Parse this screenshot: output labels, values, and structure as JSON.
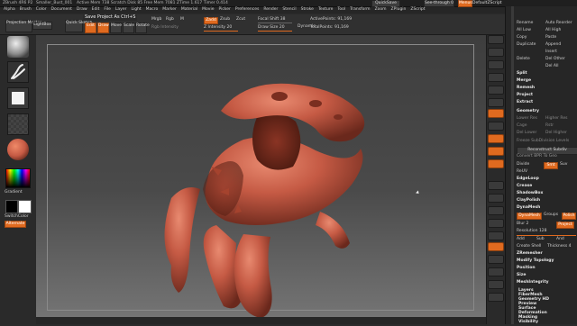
{
  "titlebar": {
    "app": "ZBrush 4R6 P2",
    "doc": "Smaller_Bust_001",
    "stats": "Active Mem 738  Scratch Disk 85  Free Mem 7081  ZTime 1.617  Timer 0.414",
    "quicksave": "QuickSave",
    "seethrough": "See-through 0",
    "menus_label": "Menus",
    "default_script": "DefaultZScript"
  },
  "menubar": [
    "Alpha",
    "Brush",
    "Color",
    "Document",
    "Draw",
    "Edit",
    "File",
    "Layer",
    "Light",
    "Macro",
    "Marker",
    "Material",
    "Movie",
    "Picker",
    "Preferences",
    "Render",
    "Stencil",
    "Stroke",
    "Texture",
    "Tool",
    "Transform",
    "Zoom",
    "ZPlugin",
    "ZScript"
  ],
  "toolbar": {
    "projection_master": "Projection Master",
    "lightbox": "LightBox",
    "quick_sketch": "Quick Sketch",
    "save_tooltip": "Save Project As  Ctrl+S",
    "edit": "Edit",
    "draw": "Draw",
    "move": "Move",
    "scale": "Scale",
    "rotate": "Rotate",
    "mrgb": "Mrgb",
    "rgb": "Rgb",
    "m": "M",
    "rgb_intensity": "Rgb Intensity",
    "zadd": "Zadd",
    "zsub": "Zsub",
    "zcut": "Zcut",
    "z_intensity": "Z Intensity 20",
    "focal_shift": "Focal Shift 38",
    "draw_size": "Draw Size 20",
    "dynamic": "Dynamic",
    "active_points": "ActivePoints: 91,169",
    "total_points": "TotalPoints: 91,169"
  },
  "leftshelf": {
    "gradient": "Gradient",
    "switchcolor": "SwitchColor",
    "alternate": "Alternate"
  },
  "trays": {
    "rows": [
      {
        "l": "Rename",
        "r": "Auto Reorder"
      },
      {
        "l": "All Low",
        "r": "All High"
      },
      {
        "l": "Copy",
        "r": "Paste"
      },
      {
        "l": "Duplicate",
        "r": "Append"
      },
      {
        "l": "",
        "r": "Insert"
      },
      {
        "l": "Delete",
        "r": "Del Other"
      },
      {
        "l": "",
        "r": "Del All"
      },
      {
        "l": "Split",
        "r": ""
      },
      {
        "l": "Merge",
        "r": ""
      },
      {
        "l": "Remesh",
        "r": ""
      },
      {
        "l": "Project",
        "r": ""
      },
      {
        "l": "Extract",
        "r": ""
      }
    ],
    "geometry": "Geometry",
    "subdiv": [
      "Lower Res",
      "Higher Res",
      "Cage",
      "Rstr",
      "Del Lower",
      "Del Higher",
      "Freeze SubDivision Levels"
    ],
    "reconstruct": "Reconstruct Subdiv",
    "convert_bpr": "Convert BPR To Geo",
    "divide": "Divide",
    "smt": "Smt",
    "suv": "Suv",
    "reuv": "ReUV",
    "edgeloop": "EdgeLoop",
    "crease": "Crease",
    "shadowbox": "ShadowBox",
    "claypolish": "ClayPolish",
    "dynamesh_head": "DynaMesh",
    "dynamesh_btn": "DynaMesh",
    "groups": "Groups",
    "polish": "Polish",
    "blur": "Blur 2",
    "project": "Project",
    "resolution": "Resolution 128",
    "add": "Add",
    "sub": "Sub",
    "and": "And",
    "create_shell": "Create Shell",
    "thickness": "Thickness 4",
    "zremesher": "ZRemesher",
    "modify_topology": "Modify Topology",
    "position": "Position",
    "size": "Size",
    "meshintegrity": "MeshIntegrity",
    "sections": [
      "Layers",
      "FiberMesh",
      "Geometry HD",
      "Preview",
      "Surface",
      "Deformation",
      "Masking",
      "Visibility"
    ]
  },
  "colors": {
    "accent": "#e06a1f",
    "sculpt": "#c55a44",
    "background": "#2b2b2b"
  }
}
